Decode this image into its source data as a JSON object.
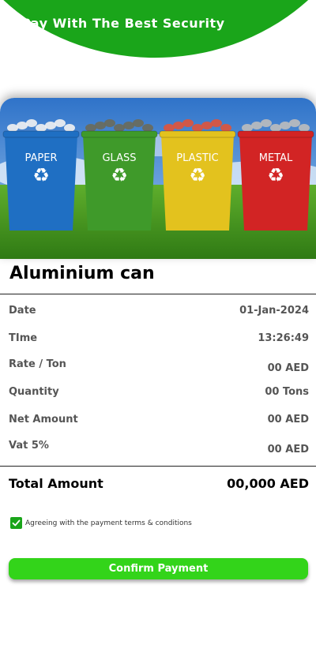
{
  "header": {
    "title": "Pay With The Best Security"
  },
  "hero": {
    "bins": [
      {
        "label": "PAPER",
        "color": "#1f6fc3"
      },
      {
        "label": "GLASS",
        "color": "#3f9a2a"
      },
      {
        "label": "PLASTIC",
        "color": "#e3c21e"
      },
      {
        "label": "METAL",
        "color": "#d22424"
      }
    ]
  },
  "product": {
    "title": "Aluminium can"
  },
  "details": [
    {
      "label": "Date",
      "value": "01-Jan-2024"
    },
    {
      "label": "TIme",
      "value": "13:26:49"
    },
    {
      "label": "Rate / Ton",
      "value": "00 AED"
    },
    {
      "label": "Quantity",
      "value": "00 Tons"
    },
    {
      "label": "Net Amount",
      "value": "00 AED"
    },
    {
      "label": "Vat 5%",
      "value": "00 AED"
    }
  ],
  "total": {
    "label": "Total Amount",
    "value": "00,000 AED"
  },
  "terms": {
    "text": "Agreeing with the payment terms & conditions",
    "checked": true
  },
  "confirm": {
    "label": "Confirm Payment"
  },
  "colors": {
    "brand_green": "#1aa51a",
    "button_green": "#33d41a"
  }
}
